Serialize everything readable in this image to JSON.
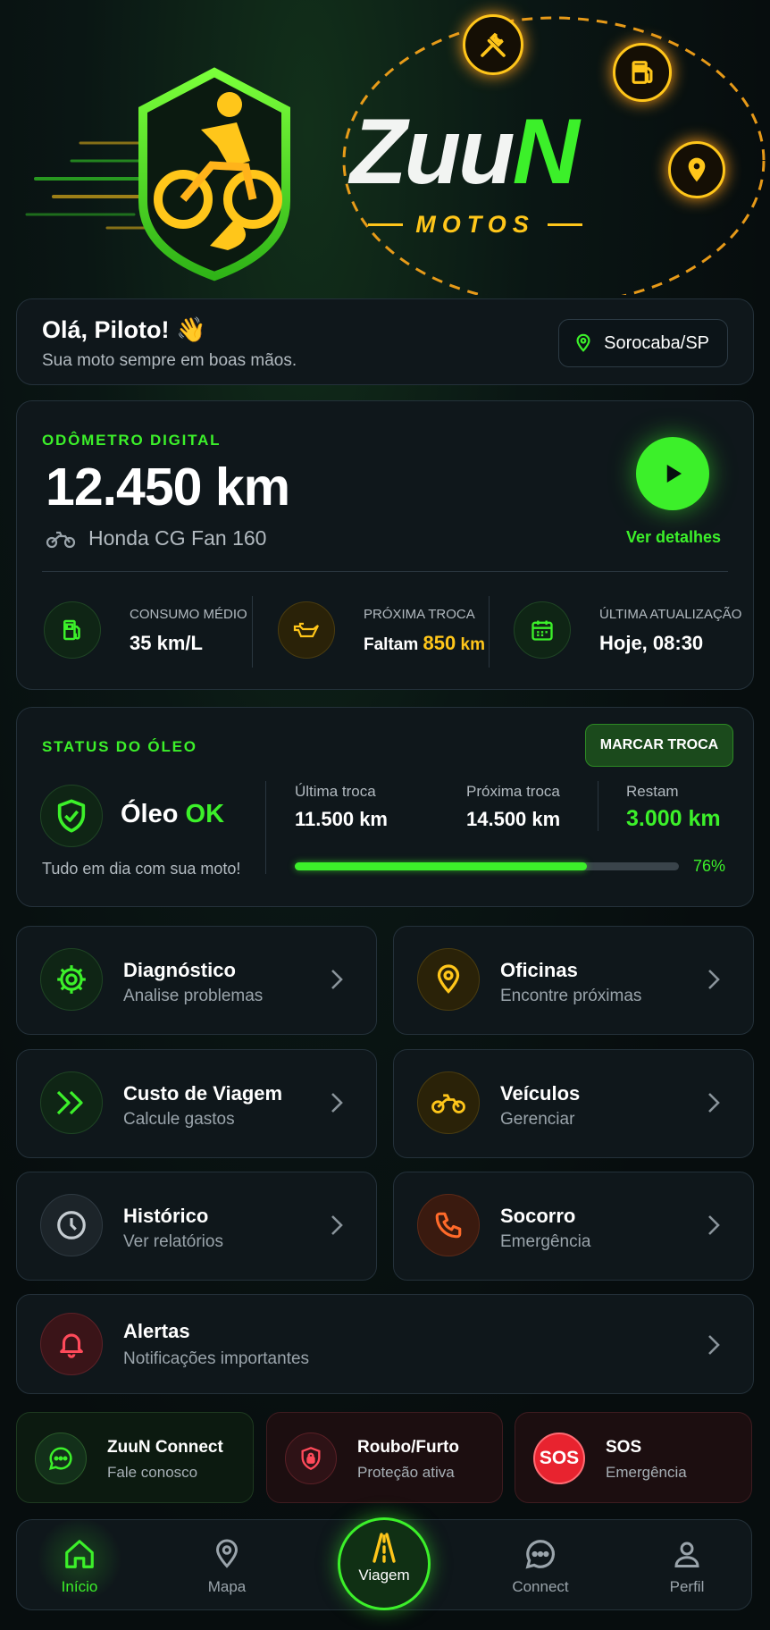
{
  "brand": {
    "name_part1": "Zuu",
    "name_part2": "N",
    "subtitle": "MOTOS"
  },
  "greeting": {
    "title": "Olá, Piloto! 👋",
    "subtitle": "Sua moto sempre em boas mãos.",
    "location": "Sorocaba/SP"
  },
  "odometer": {
    "label": "ODÔMETRO DIGITAL",
    "value": "12.450 km",
    "bike": "Honda CG Fan 160",
    "details_link": "Ver detalhes",
    "stats": [
      {
        "label": "CONSUMO MÉDIO",
        "value": "35 km/L"
      },
      {
        "label": "PRÓXIMA TROCA",
        "prefix": "Faltam",
        "value": "850",
        "unit": "km"
      },
      {
        "label": "ÚLTIMA ATUALIZAÇÃO",
        "value": "Hoje, 08:30"
      }
    ]
  },
  "oil": {
    "label": "STATUS DO ÓLEO",
    "button": "MARCAR TROCA",
    "status_prefix": "Óleo",
    "status_value": "OK",
    "message": "Tudo em dia com sua moto!",
    "last_label": "Última troca",
    "last_value": "11.500 km",
    "next_label": "Próxima troca",
    "next_value": "14.500 km",
    "remain_label": "Restam",
    "remain_value": "3.000 km",
    "progress_pct": 76,
    "progress_text": "76%"
  },
  "tiles": [
    {
      "title": "Diagnóstico",
      "subtitle": "Analise problemas"
    },
    {
      "title": "Oficinas",
      "subtitle": "Encontre próximas"
    },
    {
      "title": "Custo de Viagem",
      "subtitle": "Calcule gastos"
    },
    {
      "title": "Veículos",
      "subtitle": "Gerenciar"
    },
    {
      "title": "Histórico",
      "subtitle": "Ver relatórios"
    },
    {
      "title": "Socorro",
      "subtitle": "Emergência"
    },
    {
      "title": "Alertas",
      "subtitle": "Notificações importantes"
    }
  ],
  "actions": [
    {
      "title": "ZuuN Connect",
      "subtitle": "Fale conosco"
    },
    {
      "title": "Roubo/Furto",
      "subtitle": "Proteção ativa"
    },
    {
      "title": "SOS",
      "subtitle": "Emergência",
      "badge": "SOS"
    }
  ],
  "nav": {
    "home": "Início",
    "map": "Mapa",
    "trip": "Viagem",
    "connect": "Connect",
    "profile": "Perfil"
  },
  "colors": {
    "accent": "#3cf02a",
    "warning": "#ffc61a",
    "danger": "#e8323c",
    "background": "#070d0e"
  }
}
